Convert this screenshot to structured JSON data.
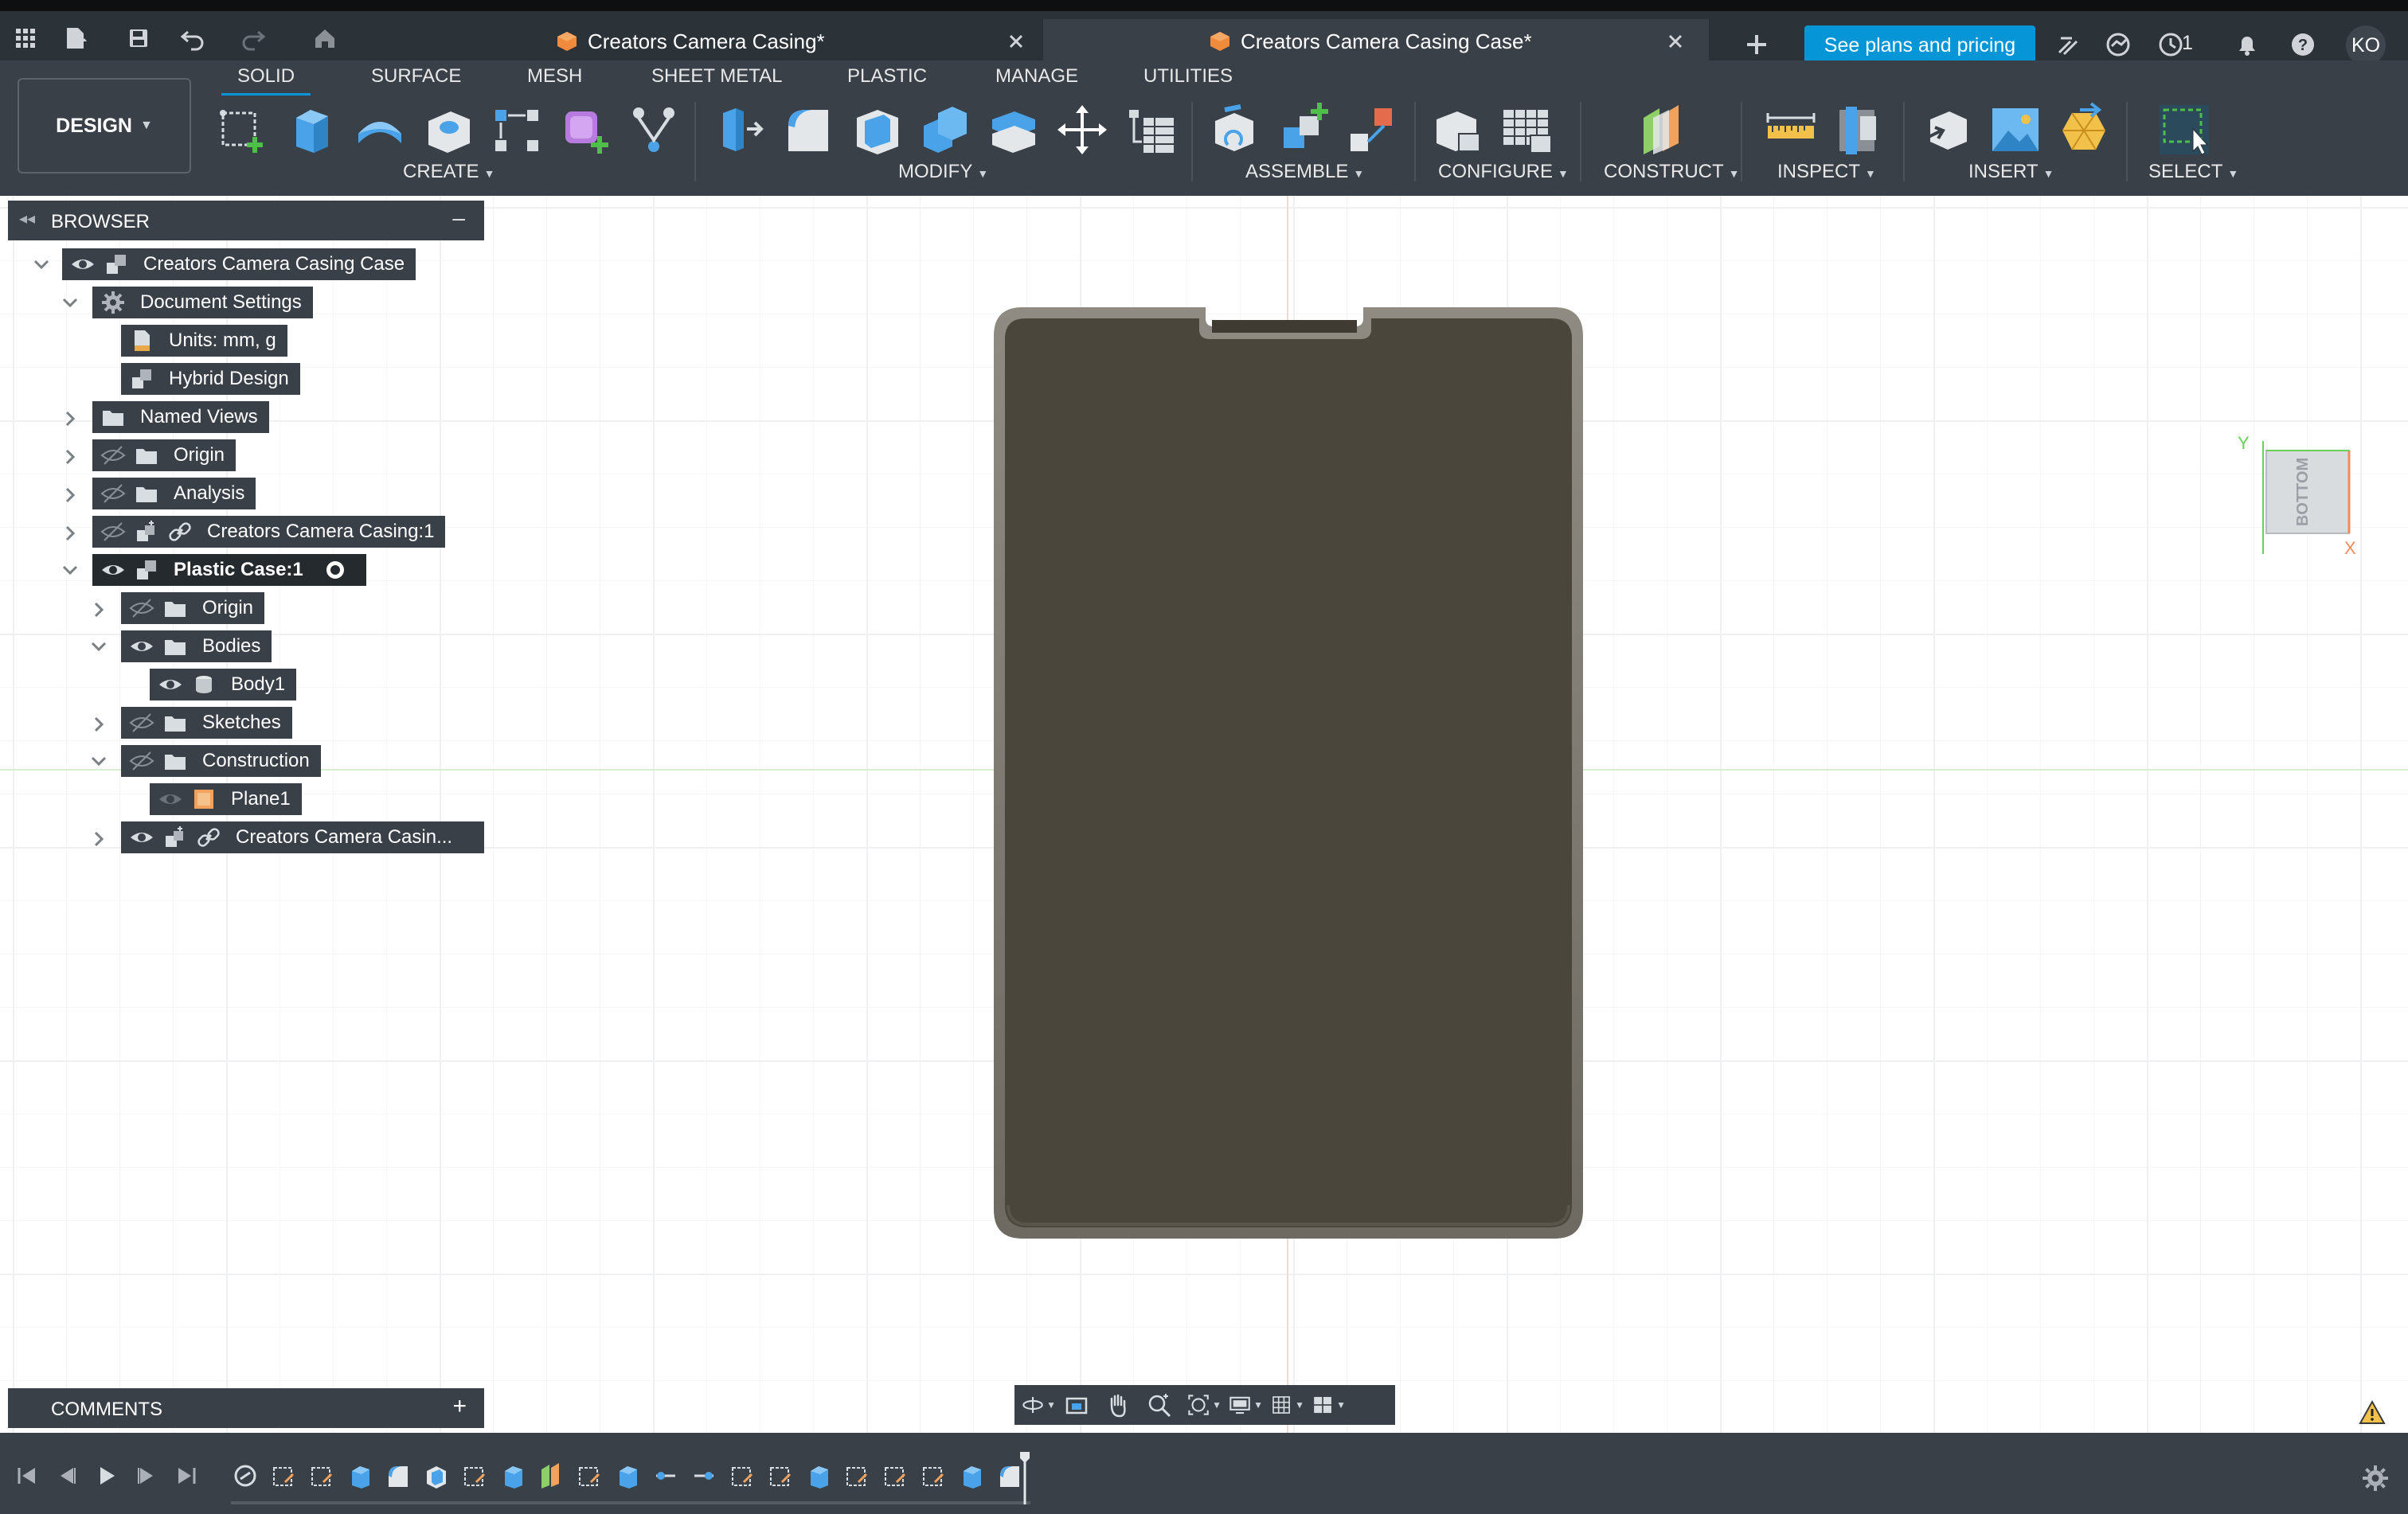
{
  "tabs": [
    {
      "title": "Creators Camera Casing*",
      "active": false
    },
    {
      "title": "Creators Camera Casing Case*",
      "active": true
    }
  ],
  "header": {
    "plans_button": "See plans and pricing",
    "job_count": "1",
    "avatar_initials": "KO"
  },
  "ribbon": {
    "workspace": "DESIGN",
    "tabs": [
      "SOLID",
      "SURFACE",
      "MESH",
      "SHEET METAL",
      "PLASTIC",
      "MANAGE",
      "UTILITIES"
    ],
    "active_tab": "SOLID",
    "groups": [
      "CREATE",
      "MODIFY",
      "ASSEMBLE",
      "CONFIGURE",
      "CONSTRUCT",
      "INSPECT",
      "INSERT",
      "SELECT"
    ]
  },
  "browser": {
    "title": "BROWSER",
    "nodes": [
      {
        "label": "Creators Camera Casing Case",
        "icon": "component-icon",
        "eye": "visible",
        "expand": "open"
      },
      {
        "label": "Document Settings",
        "icon": "gear-icon",
        "expand": "open"
      },
      {
        "label": "Units: mm, g",
        "icon": "document-icon"
      },
      {
        "label": "Hybrid Design",
        "icon": "component-icon"
      },
      {
        "label": "Named Views",
        "icon": "folder-icon",
        "expand": "closed"
      },
      {
        "label": "Origin",
        "icon": "folder-icon",
        "eye": "hidden",
        "expand": "closed"
      },
      {
        "label": "Analysis",
        "icon": "folder-icon",
        "eye": "hidden",
        "expand": "closed"
      },
      {
        "label": "Creators Camera Casing:1",
        "icon": "linked-component-icon",
        "eye": "hidden",
        "expand": "closed"
      },
      {
        "label": "Plastic Case:1",
        "icon": "component-icon",
        "eye": "visible",
        "expand": "open",
        "active": true
      },
      {
        "label": "Origin",
        "icon": "folder-icon",
        "eye": "hidden",
        "expand": "closed"
      },
      {
        "label": "Bodies",
        "icon": "folder-icon",
        "eye": "visible",
        "expand": "open"
      },
      {
        "label": "Body1",
        "icon": "body-icon",
        "eye": "visible"
      },
      {
        "label": "Sketches",
        "icon": "folder-icon",
        "eye": "hidden",
        "expand": "closed"
      },
      {
        "label": "Construction",
        "icon": "folder-icon",
        "eye": "hidden",
        "expand": "open"
      },
      {
        "label": "Plane1",
        "icon": "plane-icon",
        "eye": "visible"
      },
      {
        "label": "Creators Camera Casin...",
        "icon": "linked-component-icon",
        "eye": "visible",
        "expand": "closed"
      }
    ]
  },
  "comments": {
    "title": "COMMENTS"
  },
  "viewcube": {
    "face": "BOTTOM",
    "axis_y": "Y",
    "axis_x": "X"
  },
  "colors": {
    "accent": "#0696d7",
    "panel": "#3a4047",
    "titlebar": "#2b3238",
    "body": "#4b463c"
  }
}
